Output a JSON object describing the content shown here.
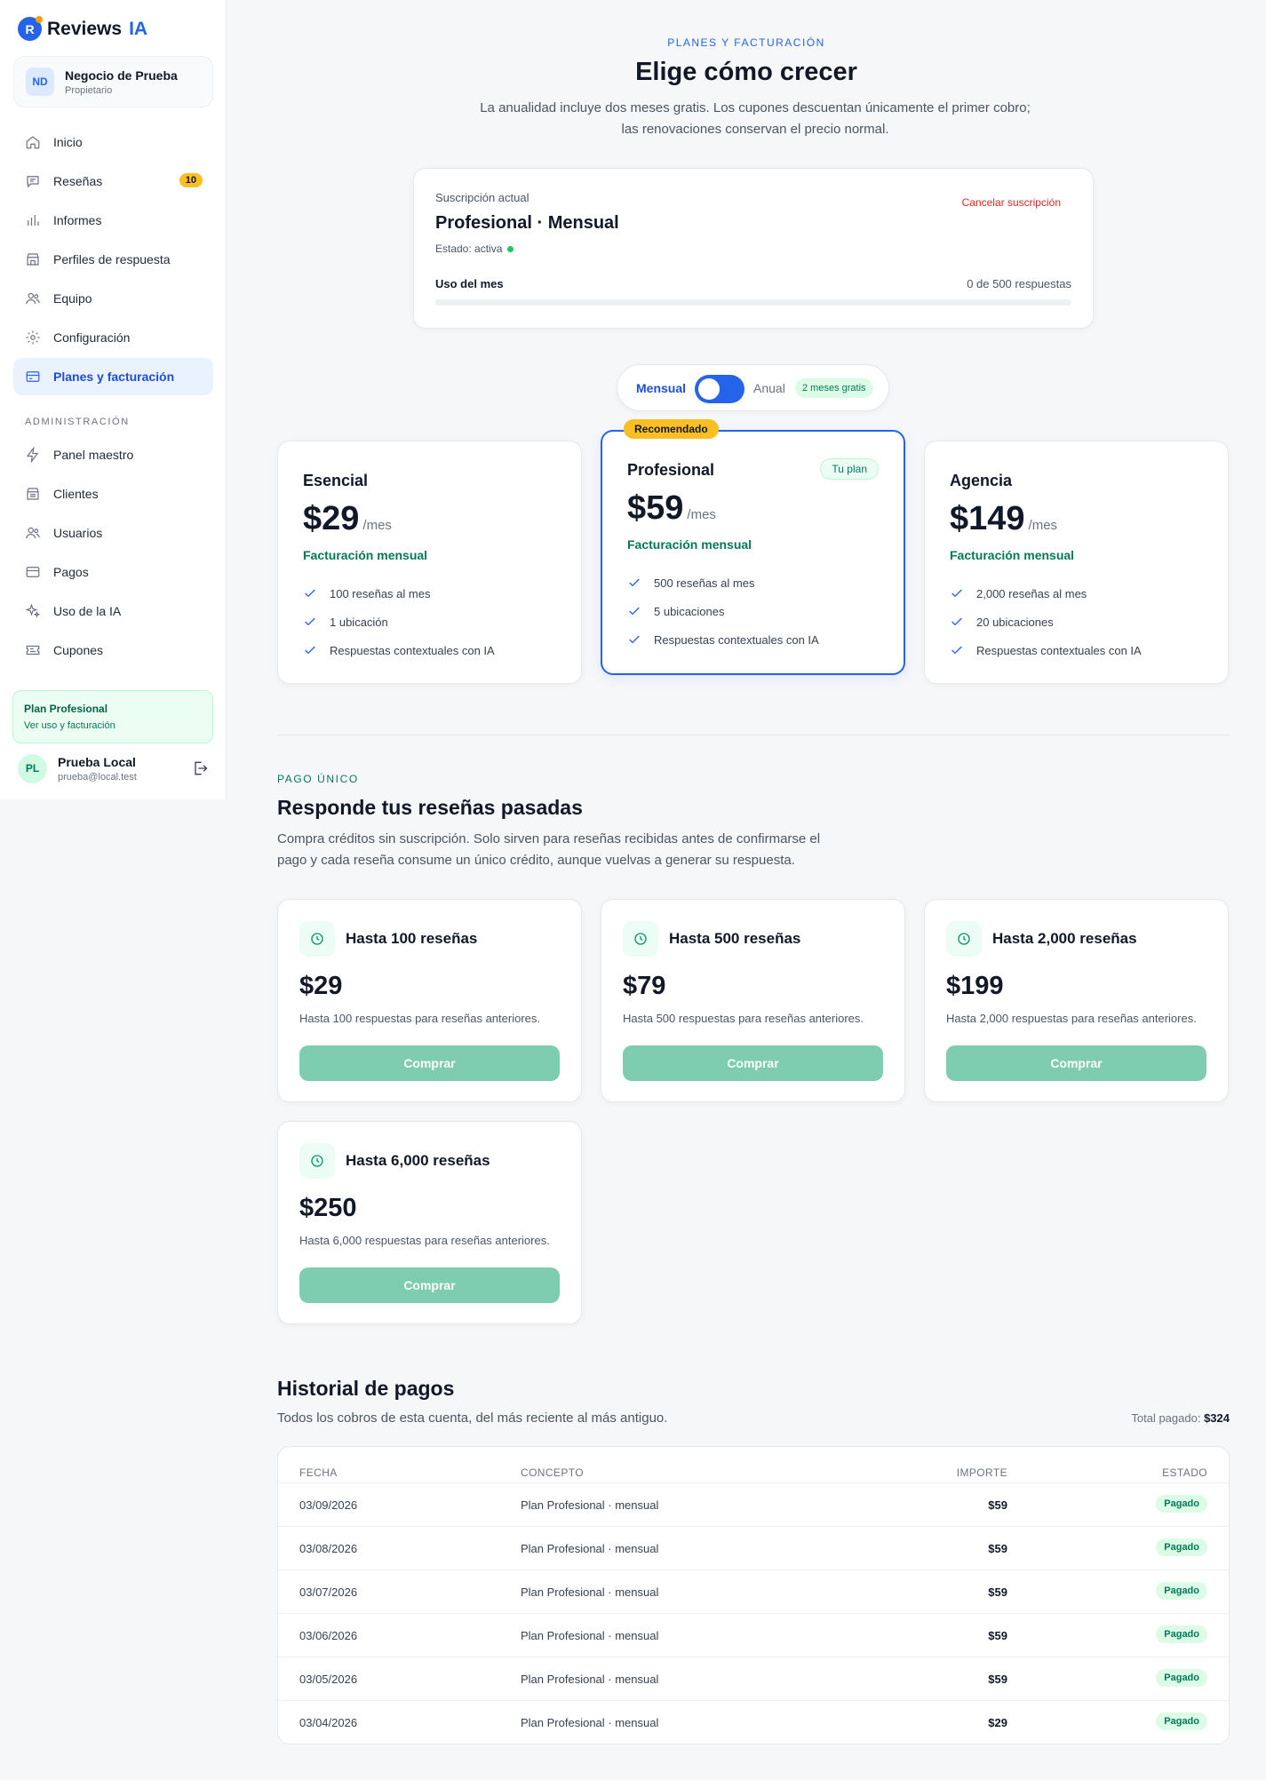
{
  "brand": {
    "name": "Reviews",
    "accent": "IA",
    "logo_letter": "R"
  },
  "business": {
    "initials": "ND",
    "name": "Negocio de Prueba",
    "role": "Propietario"
  },
  "nav": {
    "items": [
      {
        "label": "Inicio",
        "icon": "home-icon"
      },
      {
        "label": "Reseñas",
        "icon": "chat-icon",
        "badge": "10"
      },
      {
        "label": "Informes",
        "icon": "bar-chart-icon"
      },
      {
        "label": "Perfiles de respuesta",
        "icon": "store-icon"
      },
      {
        "label": "Equipo",
        "icon": "users-icon"
      },
      {
        "label": "Configuración",
        "icon": "gear-icon"
      },
      {
        "label": "Planes y facturación",
        "icon": "credit-card-icon",
        "active": true
      }
    ],
    "admin_section": "ADMINISTRACIÓN",
    "admin_items": [
      {
        "label": "Panel maestro",
        "icon": "bolt-icon"
      },
      {
        "label": "Clientes",
        "icon": "building-icon"
      },
      {
        "label": "Usuarios",
        "icon": "users-icon"
      },
      {
        "label": "Pagos",
        "icon": "credit-card-icon"
      },
      {
        "label": "Uso de la IA",
        "icon": "sparkles-icon"
      },
      {
        "label": "Cupones",
        "icon": "ticket-icon"
      }
    ]
  },
  "sidebar_plan": {
    "title": "Plan Profesional",
    "link": "Ver uso y facturación"
  },
  "user": {
    "initials": "PL",
    "name": "Prueba Local",
    "email": "prueba@local.test"
  },
  "header": {
    "eyebrow": "PLANES Y FACTURACIÓN",
    "title": "Elige cómo crecer",
    "subtitle_line1": "La anualidad incluye dos meses gratis. Los cupones descuentan únicamente el primer cobro;",
    "subtitle_line2": "las renovaciones conservan el precio normal."
  },
  "subscription": {
    "label": "Suscripción actual",
    "plan": "Profesional · Mensual",
    "status": "Estado: activa",
    "cancel": "Cancelar suscripción",
    "usage_label": "Uso del mes",
    "usage_count": "0 de 500 respuestas",
    "usage_fraction": 0
  },
  "billing_toggle": {
    "monthly": "Mensual",
    "annual": "Anual",
    "badge": "2 meses gratis",
    "selected": "Mensual"
  },
  "plans": [
    {
      "name": "Esencial",
      "price": "$29",
      "per": "/mes",
      "billing": "Facturación mensual",
      "features": [
        "100 reseñas al mes",
        "1 ubicación",
        "Respuestas contextuales con IA"
      ]
    },
    {
      "name": "Profesional",
      "price": "$59",
      "per": "/mes",
      "billing": "Facturación mensual",
      "badge": "Recomendado",
      "current": "Tu plan",
      "features": [
        "500 reseñas al mes",
        "5 ubicaciones",
        "Respuestas contextuales con IA"
      ]
    },
    {
      "name": "Agencia",
      "price": "$149",
      "per": "/mes",
      "billing": "Facturación mensual",
      "features": [
        "2,000 reseñas al mes",
        "20 ubicaciones",
        "Respuestas contextuales con IA"
      ]
    }
  ],
  "one_time": {
    "eyebrow": "PAGO ÚNICO",
    "title": "Responde tus reseñas pasadas",
    "subtitle_line1": "Compra créditos sin suscripción. Solo sirven para reseñas recibidas antes de confirmarse el",
    "subtitle_line2": "pago y cada reseña consume un único crédito, aunque vuelvas a generar su respuesta.",
    "buy_label": "Comprar",
    "packs": [
      {
        "name": "Hasta 100 reseñas",
        "price": "$29",
        "desc": "Hasta 100 respuestas para reseñas anteriores."
      },
      {
        "name": "Hasta 500 reseñas",
        "price": "$79",
        "desc": "Hasta 500 respuestas para reseñas anteriores."
      },
      {
        "name": "Hasta 2,000 reseñas",
        "price": "$199",
        "desc": "Hasta 2,000 respuestas para reseñas anteriores."
      },
      {
        "name": "Hasta 6,000 reseñas",
        "price": "$250",
        "desc": "Hasta 6,000 respuestas para reseñas anteriores."
      }
    ]
  },
  "history": {
    "title": "Historial de pagos",
    "subtitle": "Todos los cobros de esta cuenta, del más reciente al más antiguo.",
    "total_label": "Total pagado:",
    "total_value": "$324",
    "columns": {
      "date": "FECHA",
      "concept": "CONCEPTO",
      "amount": "IMPORTE",
      "status": "ESTADO"
    },
    "rows": [
      {
        "date": "03/09/2026",
        "concept": "Plan Profesional · mensual",
        "amount": "$59",
        "status": "Pagado"
      },
      {
        "date": "03/08/2026",
        "concept": "Plan Profesional · mensual",
        "amount": "$59",
        "status": "Pagado"
      },
      {
        "date": "03/07/2026",
        "concept": "Plan Profesional · mensual",
        "amount": "$59",
        "status": "Pagado"
      },
      {
        "date": "03/06/2026",
        "concept": "Plan Profesional · mensual",
        "amount": "$59",
        "status": "Pagado"
      },
      {
        "date": "03/05/2026",
        "concept": "Plan Profesional · mensual",
        "amount": "$59",
        "status": "Pagado"
      },
      {
        "date": "03/04/2026",
        "concept": "Plan Profesional · mensual",
        "amount": "$29",
        "status": "Pagado"
      }
    ]
  },
  "colors": {
    "accent": "#2563eb",
    "success": "#047857",
    "warning": "#fbbf24",
    "danger": "#dc2626",
    "buy_button": "#7fcdb1"
  }
}
